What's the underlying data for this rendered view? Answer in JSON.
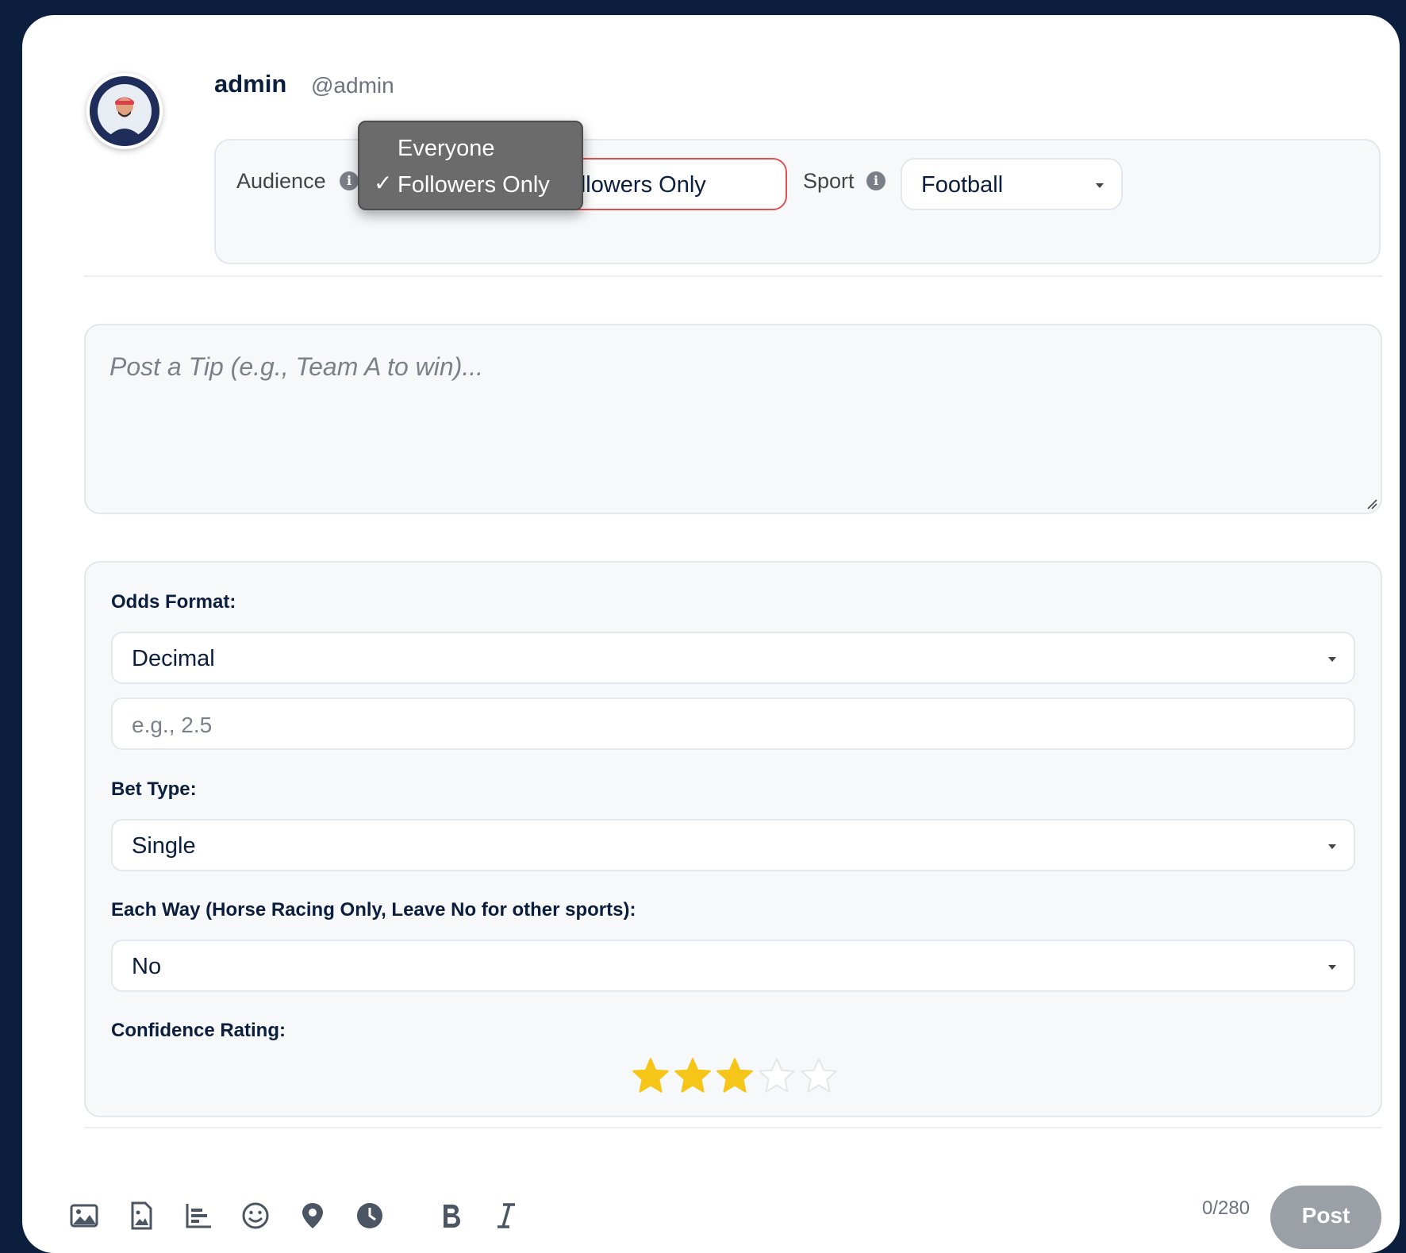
{
  "user": {
    "name": "admin",
    "handle": "@admin"
  },
  "audience": {
    "label": "Audience",
    "options": [
      "Everyone",
      "Followers Only"
    ],
    "selected": "Followers Only",
    "check_glyph": "✓"
  },
  "sport": {
    "label": "Sport",
    "value": "Football"
  },
  "tip": {
    "placeholder": "Post a Tip (e.g., Team A to win)..."
  },
  "form": {
    "odds_format_label": "Odds Format:",
    "odds_format_value": "Decimal",
    "odds_placeholder": "e.g., 2.5",
    "bet_type_label": "Bet Type:",
    "bet_type_value": "Single",
    "each_way_label": "Each Way (Horse Racing Only, Leave No for other sports):",
    "each_way_value": "No",
    "confidence_label": "Confidence Rating:",
    "confidence_rating": 3,
    "confidence_max": 5
  },
  "toolbar": {
    "icons": [
      "image-icon",
      "gif-icon",
      "poll-icon",
      "emoji-icon",
      "location-icon",
      "schedule-icon",
      "bold-icon",
      "italic-icon"
    ],
    "counter": "0/280",
    "post_label": "Post"
  },
  "colors": {
    "background": "#0b1e3d",
    "star_filled": "#f5c518",
    "star_empty": "#e5e7eb",
    "post_button": "#9aa0a6",
    "audience_border": "#e05252"
  }
}
